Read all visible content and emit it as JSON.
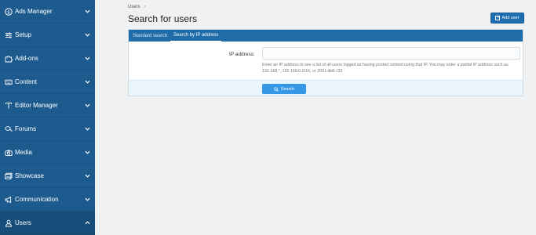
{
  "sidebar": {
    "items": [
      {
        "label": "Ads Manager",
        "icon": "dollar-circle-icon",
        "chevron": "down"
      },
      {
        "label": "Setup",
        "icon": "sliders-icon",
        "chevron": "down"
      },
      {
        "label": "Add-ons",
        "icon": "puzzle-icon",
        "chevron": "down"
      },
      {
        "label": "Content",
        "icon": "keyboard-icon",
        "chevron": "down"
      },
      {
        "label": "Editor Manager",
        "icon": "editor-icon",
        "chevron": "down"
      },
      {
        "label": "Forums",
        "icon": "comments-icon",
        "chevron": "down"
      },
      {
        "label": "Media",
        "icon": "camera-icon",
        "chevron": "down"
      },
      {
        "label": "Showcase",
        "icon": "images-icon",
        "chevron": "down"
      },
      {
        "label": "Communication",
        "icon": "megaphone-icon",
        "chevron": "down"
      },
      {
        "label": "Users",
        "icon": "user-icon",
        "chevron": "up"
      }
    ]
  },
  "breadcrumb": {
    "items": [
      "Users"
    ]
  },
  "page": {
    "title": "Search for users",
    "add_user_label": "Add user"
  },
  "tabs": [
    {
      "label": "Standard search",
      "active": false
    },
    {
      "label": "Search by IP address",
      "active": true
    }
  ],
  "form": {
    "ip_label": "IP address:",
    "ip_value": "",
    "hint": "Enter an IP address to see a list of all users logged as having posted content using that IP. You may enter a partial IP address such as 192.168.*, 192.168.0.0/16, or 2001:db8::/32.",
    "search_label": "Search"
  },
  "colors": {
    "sidebar": "#1d5b8e",
    "accent": "#1f6ca9",
    "button": "#3597e6"
  }
}
